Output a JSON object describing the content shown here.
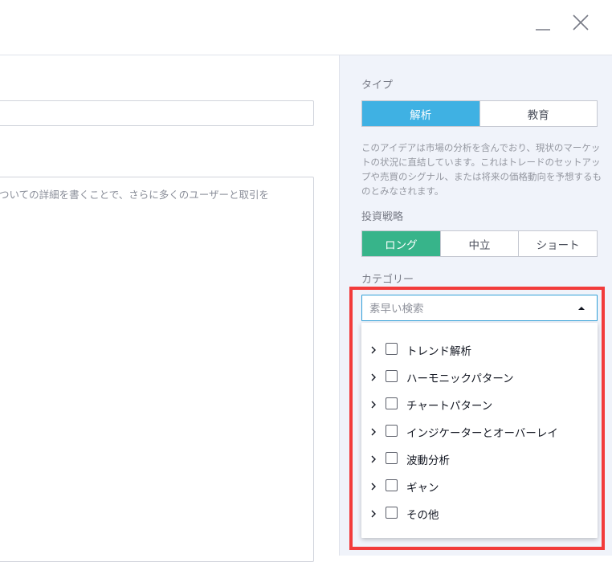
{
  "window": {
    "minimize_icon": "minimize-icon",
    "close_icon": "close-icon"
  },
  "main": {
    "title_value": "",
    "description_text": "ついての詳細を書くことで、さらに多くのユーザーと取引を"
  },
  "sidebar": {
    "type_label": "タイプ",
    "type_options": [
      "解析",
      "教育"
    ],
    "type_selected": "解析",
    "type_description": "このアイデアは市場の分析を含んでおり、現状のマーケットの状況に直結しています。これはトレードのセットアップや売買のシグナル、または将来の価格動向を予想するものとみなされます。",
    "strategy_label": "投資戦略",
    "strategy_options": [
      "ロング",
      "中立",
      "ショート"
    ],
    "strategy_selected": "ロング",
    "category_label": "カテゴリー",
    "category_search_placeholder": "素早い検索",
    "category_search_value": "",
    "categories": [
      "トレンド解析",
      "ハーモニックパターン",
      "チャートパターン",
      "インジケーターとオーバーレイ",
      "波動分析",
      "ギャン",
      "その他"
    ]
  },
  "colors": {
    "accent_blue": "#3fb1e3",
    "accent_green": "#37b48a",
    "highlight_red": "#f23b3b"
  }
}
